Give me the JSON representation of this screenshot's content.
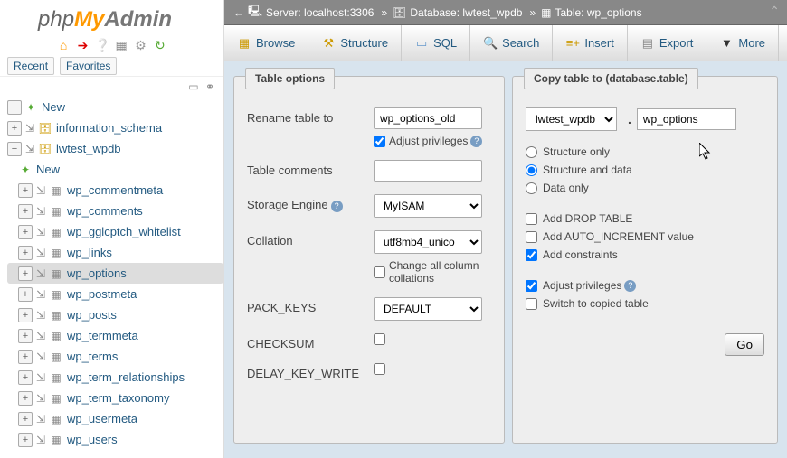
{
  "logo": {
    "php": "php",
    "my": "My",
    "admin": "Admin"
  },
  "sidebar_tabs": {
    "recent": "Recent",
    "favorites": "Favorites"
  },
  "tree": {
    "new": "New",
    "db1": "information_schema",
    "db2": "lwtest_wpdb",
    "db2_new": "New",
    "tables": [
      "wp_commentmeta",
      "wp_comments",
      "wp_gglcptch_whitelist",
      "wp_links",
      "wp_options",
      "wp_postmeta",
      "wp_posts",
      "wp_termmeta",
      "wp_terms",
      "wp_term_relationships",
      "wp_term_taxonomy",
      "wp_usermeta",
      "wp_users"
    ],
    "active_index": 4
  },
  "breadcrumb": {
    "server_label": "Server:",
    "server": "localhost:3306",
    "db_label": "Database:",
    "db": "lwtest_wpdb",
    "table_label": "Table:",
    "table": "wp_options"
  },
  "tabs": [
    {
      "label": "Browse",
      "icon": "browse"
    },
    {
      "label": "Structure",
      "icon": "structure"
    },
    {
      "label": "SQL",
      "icon": "sql"
    },
    {
      "label": "Search",
      "icon": "search"
    },
    {
      "label": "Insert",
      "icon": "insert"
    },
    {
      "label": "Export",
      "icon": "export"
    },
    {
      "label": "More",
      "icon": "more"
    }
  ],
  "table_options": {
    "legend": "Table options",
    "rename_label": "Rename table to",
    "rename_value": "wp_options_old",
    "adjust_priv": "Adjust privileges",
    "comments_label": "Table comments",
    "comments_value": "",
    "engine_label": "Storage Engine",
    "engine_value": "MyISAM",
    "collation_label": "Collation",
    "collation_value": "utf8mb4_unico",
    "change_coll": "Change all column collations",
    "pack_keys_label": "PACK_KEYS",
    "pack_keys_value": "DEFAULT",
    "checksum_label": "CHECKSUM",
    "delay_label": "DELAY_KEY_WRITE"
  },
  "copy_table": {
    "legend": "Copy table to (database.table)",
    "db": "lwtest_wpdb",
    "table": "wp_options",
    "structure_only": "Structure only",
    "structure_data": "Structure and data",
    "data_only": "Data only",
    "drop_table": "Add DROP TABLE",
    "auto_inc": "Add AUTO_INCREMENT value",
    "constraints": "Add constraints",
    "adjust_priv": "Adjust privileges",
    "switch": "Switch to copied table",
    "go": "Go"
  }
}
